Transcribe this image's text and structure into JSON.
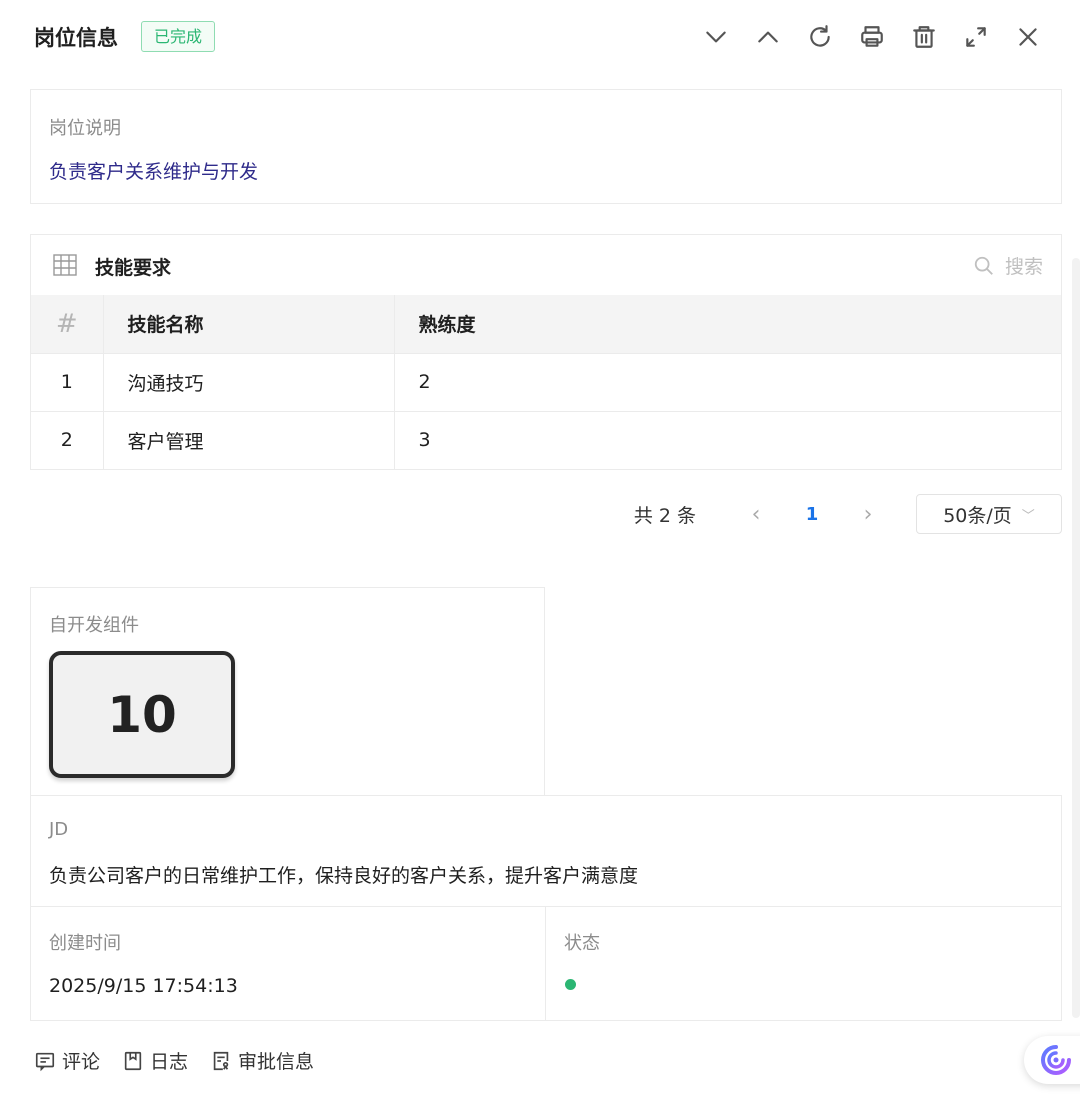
{
  "header": {
    "title": "岗位信息",
    "status_badge": "已完成",
    "toolbar_icons": [
      "chevron-down-icon",
      "chevron-up-icon",
      "refresh-icon",
      "print-icon",
      "trash-icon",
      "expand-icon",
      "close-icon"
    ]
  },
  "description": {
    "label": "岗位说明",
    "value": "负责客户关系维护与开发"
  },
  "skills": {
    "title": "技能要求",
    "search_placeholder": "搜索",
    "columns": [
      "#",
      "技能名称",
      "熟练度"
    ],
    "rows": [
      {
        "index": "1",
        "name": "沟通技巧",
        "level": "2"
      },
      {
        "index": "2",
        "name": "客户管理",
        "level": "3"
      }
    ]
  },
  "pagination": {
    "total": "共 2 条",
    "prev": "‹",
    "current_page": "1",
    "next": "›",
    "page_size": "50条/页"
  },
  "custom_component": {
    "label": "自开发组件",
    "value": "10"
  },
  "jd": {
    "label": "JD",
    "value": "负责公司客户的日常维护工作，保持良好的客户关系，提升客户满意度"
  },
  "created": {
    "label": "创建时间",
    "value": "2025/9/15 17:54:13"
  },
  "status": {
    "label": "状态",
    "dot_color": "#2bb673"
  },
  "footer_tabs": [
    {
      "label": "评论",
      "icon": "comment-icon"
    },
    {
      "label": "日志",
      "icon": "bookmark-icon"
    },
    {
      "label": "审批信息",
      "icon": "approval-icon"
    }
  ],
  "colors": {
    "accent": "#1a73e8",
    "success": "#2bb673",
    "description_text": "#2e2a8a"
  }
}
